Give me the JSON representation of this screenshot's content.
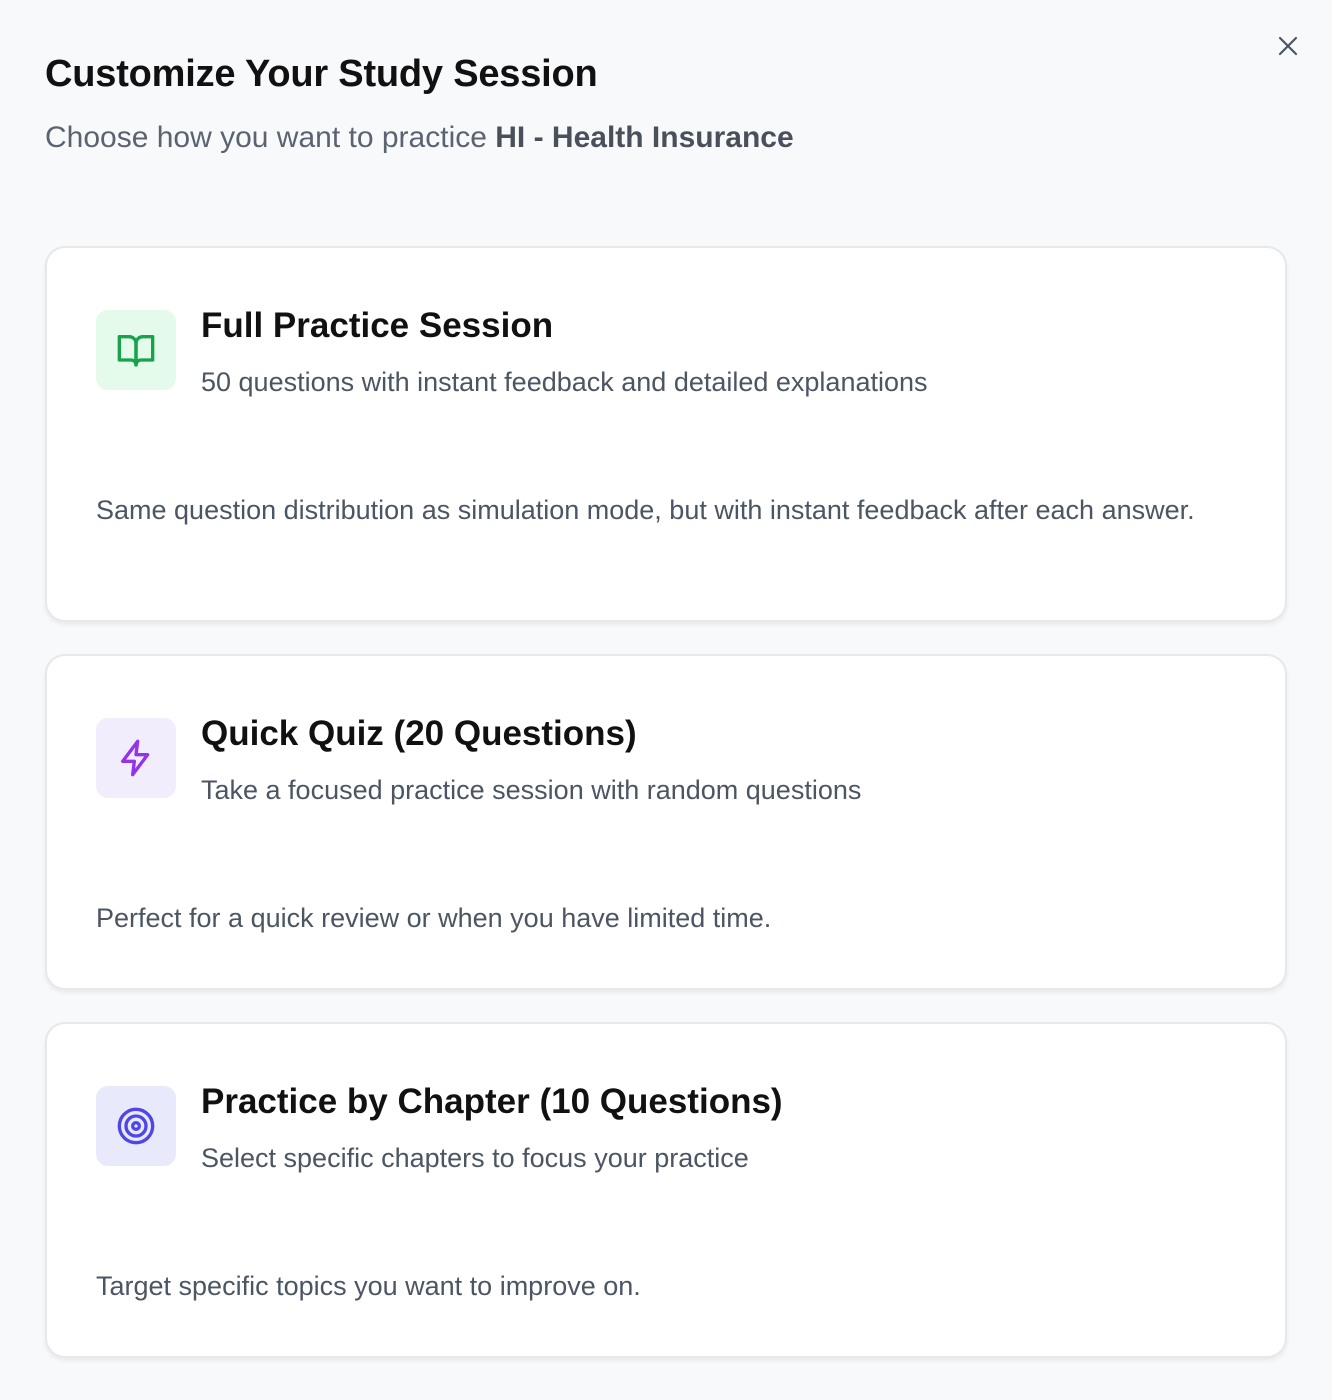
{
  "dialog": {
    "title": "Customize Your Study Session",
    "subtitle_prefix": "Choose how you want to practice ",
    "subtitle_subject": "HI - Health Insurance",
    "close_icon": "close-icon"
  },
  "options": [
    {
      "icon": "book-open-icon",
      "icon_color": "#16a34a",
      "icon_bg": "#e4faea",
      "title": "Full Practice Session",
      "description": "50 questions with instant feedback and detailed explanations",
      "note": "Same question distribution as simulation mode, but with instant feedback after each answer."
    },
    {
      "icon": "lightning-icon",
      "icon_color": "#9333ea",
      "icon_bg": "#f1edfc",
      "title": "Quick Quiz (20 Questions)",
      "description": "Take a focused practice session with random questions",
      "note": "Perfect for a quick review or when you have limited time."
    },
    {
      "icon": "target-icon",
      "icon_color": "#4f46e5",
      "icon_bg": "#e9e9fc",
      "title": "Practice by Chapter (10 Questions)",
      "description": "Select specific chapters to focus your practice",
      "note": "Target specific topics you want to improve on."
    }
  ]
}
